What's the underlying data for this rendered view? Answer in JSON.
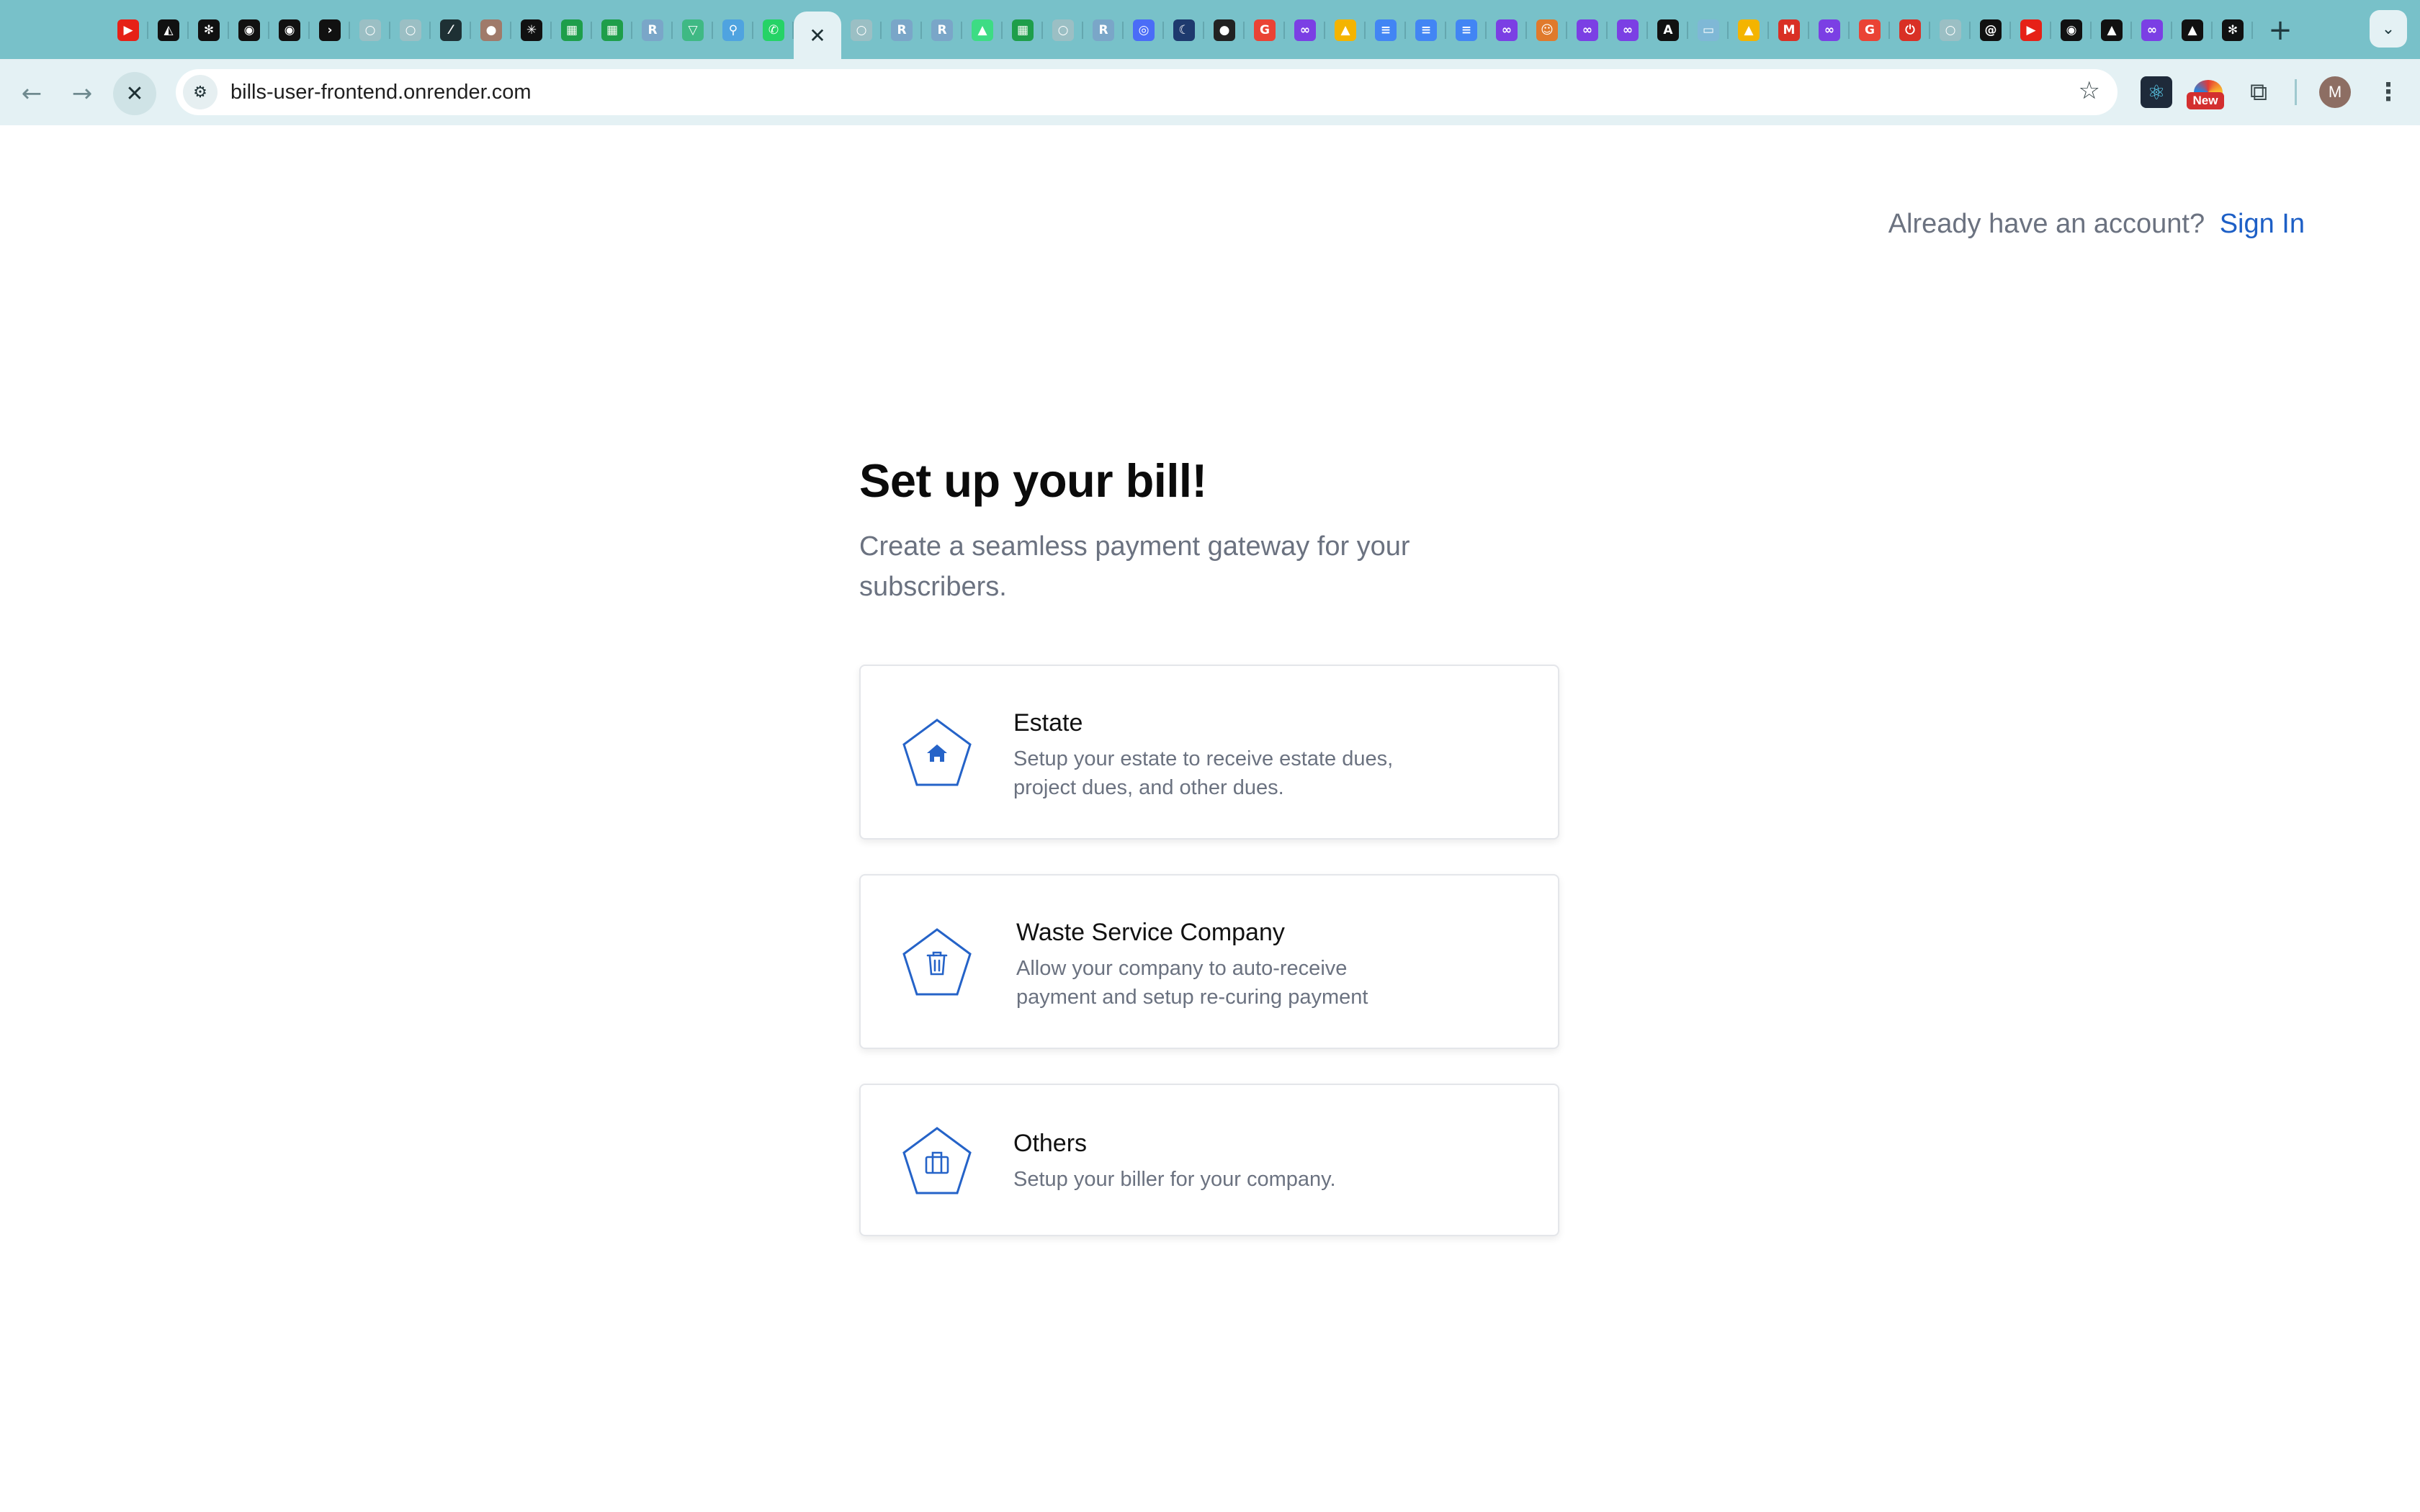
{
  "browser": {
    "tabs": [
      {
        "icon": "youtube-icon",
        "glyph": "▶",
        "bg": "#e62117"
      },
      {
        "icon": "vercel-icon",
        "glyph": "◭",
        "bg": "#111111"
      },
      {
        "icon": "openai-icon",
        "glyph": "✻",
        "bg": "#111111"
      },
      {
        "icon": "github-icon",
        "glyph": "◉",
        "bg": "#111111"
      },
      {
        "icon": "github-icon",
        "glyph": "◉",
        "bg": "#111111"
      },
      {
        "icon": "terminal-icon",
        "glyph": "›",
        "bg": "#111111"
      },
      {
        "icon": "blank-page-icon",
        "glyph": "○",
        "bg": "#9bbfc4"
      },
      {
        "icon": "blank-page-icon",
        "glyph": "○",
        "bg": "#9bbfc4"
      },
      {
        "icon": "pen-icon",
        "glyph": "⁄",
        "bg": "#1e3034"
      },
      {
        "icon": "profile-photo-icon",
        "glyph": "●",
        "bg": "#a07a6a"
      },
      {
        "icon": "perplexity-icon",
        "glyph": "✳",
        "bg": "#111111"
      },
      {
        "icon": "sheets-icon",
        "glyph": "▦",
        "bg": "#1e9e4a"
      },
      {
        "icon": "sheets-icon",
        "glyph": "▦",
        "bg": "#1e9e4a"
      },
      {
        "icon": "repo-icon",
        "glyph": "R",
        "bg": "#7aa6c8"
      },
      {
        "icon": "vue-icon",
        "glyph": "▽",
        "bg": "#3fb984"
      },
      {
        "icon": "search-tab-icon",
        "glyph": "⚲",
        "bg": "#4fa3e0"
      },
      {
        "icon": "whatsapp-icon",
        "glyph": "✆",
        "bg": "#25d366"
      },
      {
        "icon": "close-icon",
        "glyph": "✕",
        "bg": "",
        "active": true
      },
      {
        "icon": "blank-page-icon",
        "glyph": "○",
        "bg": "#9bbfc4"
      },
      {
        "icon": "repo-icon",
        "glyph": "R",
        "bg": "#7aa6c8"
      },
      {
        "icon": "repo-icon",
        "glyph": "R",
        "bg": "#7aa6c8"
      },
      {
        "icon": "android-icon",
        "glyph": "▲",
        "bg": "#3ddc84"
      },
      {
        "icon": "sheets-icon",
        "glyph": "▦",
        "bg": "#1e9e4a"
      },
      {
        "icon": "blank-page-icon",
        "glyph": "○",
        "bg": "#9bbfc4"
      },
      {
        "icon": "repo-icon",
        "glyph": "R",
        "bg": "#7aa6c8"
      },
      {
        "icon": "messenger-icon",
        "glyph": "◎",
        "bg": "#4a6cf7"
      },
      {
        "icon": "moon-icon",
        "glyph": "☾",
        "bg": "#1e3a6e"
      },
      {
        "icon": "panda-icon",
        "glyph": "●",
        "bg": "#222222"
      },
      {
        "icon": "google-icon",
        "glyph": "G",
        "bg": "#ea4335"
      },
      {
        "icon": "loop-icon",
        "glyph": "∞",
        "bg": "#7b3fe4"
      },
      {
        "icon": "drive-icon",
        "glyph": "▲",
        "bg": "#f4b400"
      },
      {
        "icon": "docs-icon",
        "glyph": "≡",
        "bg": "#4285f4"
      },
      {
        "icon": "docs-icon",
        "glyph": "≡",
        "bg": "#4285f4"
      },
      {
        "icon": "docs-icon",
        "glyph": "≡",
        "bg": "#4285f4"
      },
      {
        "icon": "loop-icon",
        "glyph": "∞",
        "bg": "#7b3fe4"
      },
      {
        "icon": "mascot-icon",
        "glyph": "☺",
        "bg": "#e07a2c"
      },
      {
        "icon": "loop-icon",
        "glyph": "∞",
        "bg": "#7b3fe4"
      },
      {
        "icon": "loop-icon",
        "glyph": "∞",
        "bg": "#7b3fe4"
      },
      {
        "icon": "adobe-icon",
        "glyph": "A",
        "bg": "#111111"
      },
      {
        "icon": "image-icon",
        "glyph": "▭",
        "bg": "#7fb8d6"
      },
      {
        "icon": "drive-icon",
        "glyph": "▲",
        "bg": "#f4b400"
      },
      {
        "icon": "gmail-icon",
        "glyph": "M",
        "bg": "#d93025"
      },
      {
        "icon": "loop-icon",
        "glyph": "∞",
        "bg": "#7b3fe4"
      },
      {
        "icon": "google-icon",
        "glyph": "G",
        "bg": "#ea4335"
      },
      {
        "icon": "power-icon",
        "glyph": "⏻",
        "bg": "#d93025"
      },
      {
        "icon": "blank-page-icon",
        "glyph": "○",
        "bg": "#9bbfc4"
      },
      {
        "icon": "threads-icon",
        "glyph": "@",
        "bg": "#111111"
      },
      {
        "icon": "youtube-icon",
        "glyph": "▶",
        "bg": "#e62117"
      },
      {
        "icon": "github-icon",
        "glyph": "◉",
        "bg": "#111111"
      },
      {
        "icon": "vercel-icon",
        "glyph": "▲",
        "bg": "#111111"
      },
      {
        "icon": "loop-icon",
        "glyph": "∞",
        "bg": "#7b3fe4"
      },
      {
        "icon": "vercel-icon",
        "glyph": "▲",
        "bg": "#111111"
      },
      {
        "icon": "openai-icon",
        "glyph": "✻",
        "bg": "#111111"
      }
    ],
    "new_tab_glyph": "+",
    "tab_search_glyph": "⌄",
    "back_glyph": "←",
    "forward_glyph": "→",
    "stop_glyph": "✕",
    "site_info_glyph": "⚙",
    "url": "bills-user-frontend.onrender.com",
    "bookmark_glyph": "☆",
    "react_ext_glyph": "⚛",
    "new_badge": "New",
    "extensions_glyph": "⧉",
    "profile_initial": "M",
    "menu_glyph": "⋮"
  },
  "page": {
    "signin_prompt": "Already have an account?",
    "signin_link": "Sign In",
    "title": "Set up your bill!",
    "subtitle": "Create a seamless payment gateway for your subscribers.",
    "accent_color": "#2563c8",
    "cards": [
      {
        "title": "Estate",
        "description": "Setup your estate to receive estate dues, project dues, and other dues.",
        "icon": "house-icon"
      },
      {
        "title": "Waste Service Company",
        "description": "Allow your company to auto-receive payment and setup re-curing payment",
        "icon": "trash-icon"
      },
      {
        "title": "Others",
        "description": "Setup your biller for your company.",
        "icon": "briefcase-icon"
      }
    ]
  }
}
